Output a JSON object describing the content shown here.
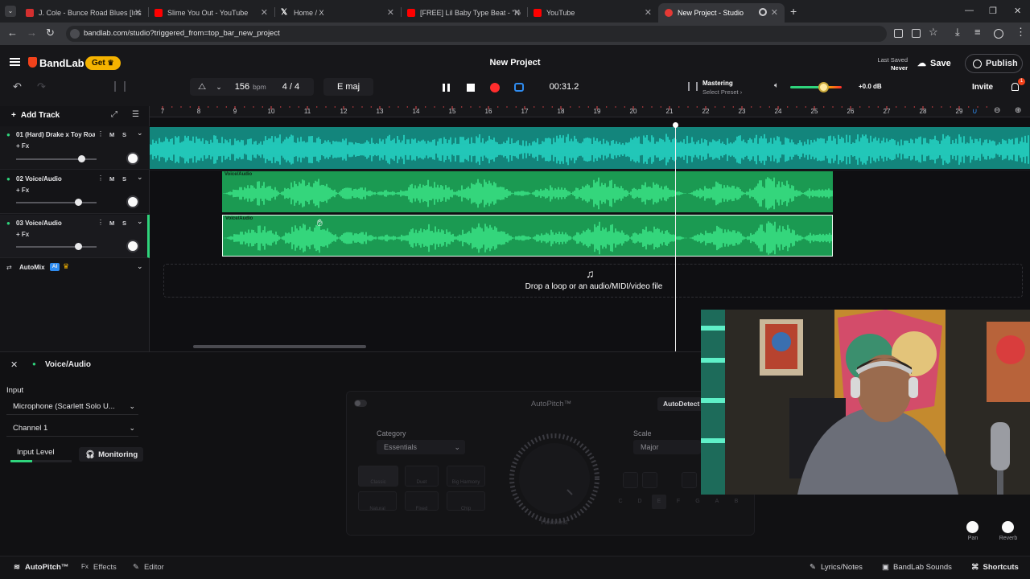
{
  "browser": {
    "tabs": [
      {
        "title": "J. Cole - Bunce Road Blues [Instr",
        "color": "#d32f2f"
      },
      {
        "title": "Slime You Out - YouTube",
        "color": "#ff0000"
      },
      {
        "title": "Home / X",
        "color": "#ffffff"
      },
      {
        "title": "[FREE] Lil Baby Type Beat - \"Ne",
        "color": "#ff0000"
      },
      {
        "title": "YouTube",
        "color": "#ff0000"
      },
      {
        "title": "New Project - Studio",
        "color": "#e53935"
      }
    ],
    "new_tab": "+",
    "url": "bandlab.com/studio?triggered_from=top_bar_new_project"
  },
  "header": {
    "brand": "BandLab",
    "get_label": "Get",
    "project_title": "New Project",
    "last_saved_label": "Last Saved",
    "last_saved_value": "Never",
    "save_label": "Save",
    "publish_label": "Publish",
    "invite_label": "Invite",
    "notification_count": "1",
    "bpm_value": "156",
    "bpm_unit": "bpm",
    "time_signature": "4 / 4",
    "key": "E maj",
    "time": "00:31.2",
    "mastering_label": "Mastering",
    "mastering_preset": "Select Preset",
    "volume_db": "+0.0 dB"
  },
  "toolbar": {
    "add_track": "Add Track"
  },
  "ruler": {
    "start": 7,
    "end": 29
  },
  "tracks": [
    {
      "name": "01 (Hard) Drake x Toy Road",
      "fx": "+ Fx",
      "mute": "M",
      "solo": "S",
      "volume": 0.77
    },
    {
      "name": "02 Voice/Audio",
      "fx": "+ Fx",
      "mute": "M",
      "solo": "S",
      "volume": 0.73
    },
    {
      "name": "03 Voice/Audio",
      "fx": "+ Fx",
      "mute": "M",
      "solo": "S",
      "volume": 0.73
    }
  ],
  "clips": [
    {
      "label": ""
    },
    {
      "label": "Voice/Audio"
    },
    {
      "label": "Voice/Audio"
    }
  ],
  "automix": {
    "label": "AutoMix",
    "badge": "AI"
  },
  "drop_zone": {
    "text": "Drop a loop or an audio/MIDI/video file"
  },
  "panel": {
    "title": "Voice/Audio",
    "input_label": "Input",
    "input_device": "Microphone (Scarlett Solo U...",
    "channel": "Channel 1",
    "input_level_label": "Input Level",
    "input_level": 0.35,
    "monitoring_label": "Monitoring",
    "autopitch_title": "AutoPitch™",
    "autodetect_label": "AutoDetect",
    "category_label": "Category",
    "category_value": "Essentials",
    "scale_label": "Scale",
    "scale_value": "Major",
    "presets": [
      "Classic",
      "Duet",
      "Big Harmony",
      "Natural",
      "Fixed",
      "Chip"
    ],
    "knob_label": "Heaviest",
    "keys": [
      "C",
      "D",
      "E",
      "F",
      "G",
      "A",
      "B"
    ],
    "scale_keys": [
      "C#\nDb",
      "D#\nEb",
      "F#\nGb"
    ],
    "pan_label": "Pan",
    "reverb_label": "Reverb"
  },
  "bottom_bar": {
    "tabs": [
      "AutoPitch™",
      "Effects",
      "Editor"
    ],
    "lyrics_label": "Lyrics/Notes",
    "sounds_label": "BandLab Sounds",
    "shortcuts_label": "Shortcuts"
  },
  "colors": {
    "accent_orange": "#f2421b",
    "clip_cyan": "#1ec8b8",
    "clip_green": "#2fd47c",
    "record_red": "#ff2d2d",
    "loop_blue": "#2f8cf0",
    "get_yellow": "#f5b300"
  }
}
